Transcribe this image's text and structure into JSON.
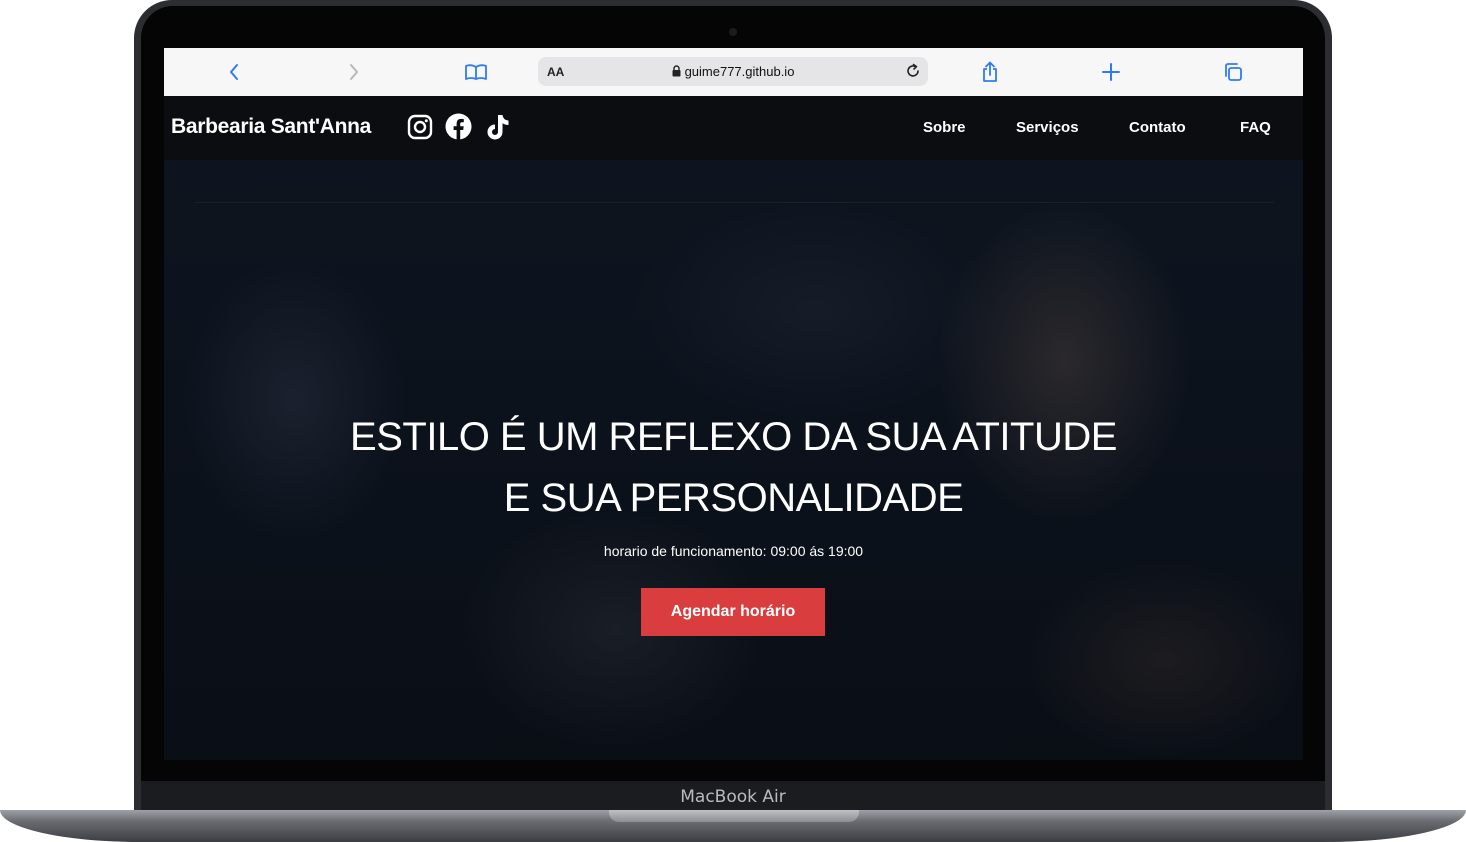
{
  "browser": {
    "reader_label": "AA",
    "url": "guime777.github.io"
  },
  "site": {
    "brand": "Barbearia Sant'Anna",
    "socials": [
      "instagram-icon",
      "facebook-icon",
      "tiktok-icon"
    ],
    "menu": [
      "Sobre",
      "Serviços",
      "Contato",
      "FAQ"
    ]
  },
  "hero": {
    "headline_line1": "ESTILO É UM REFLEXO DA SUA ATITUDE",
    "headline_line2": "E SUA PERSONALIDADE",
    "hours": "horario de funcionamento: 09:00 ás 19:00",
    "cta": "Agendar horário"
  },
  "device": {
    "label": "MacBook Air"
  },
  "colors": {
    "cta": "#d93d3d",
    "navbar": "#0c0d10",
    "browser_accent": "#2f7bf6"
  }
}
